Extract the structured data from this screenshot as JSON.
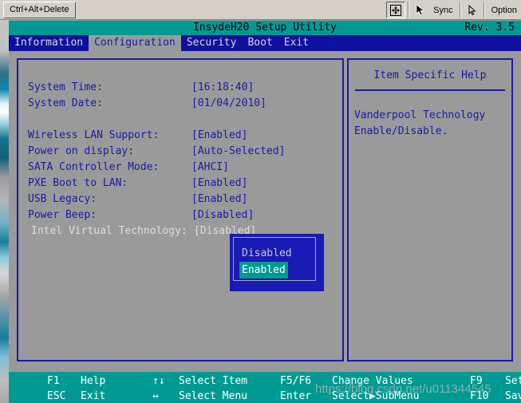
{
  "toolbar": {
    "cad_button": "Ctrl+Alt+Delete",
    "move_icon": "move-arrows-icon",
    "sync_icon": "cursor-arrow-icon",
    "sync_label": "Sync",
    "pointer_icon": "pointer-arrow-icon",
    "option_label": "Option"
  },
  "header": {
    "title": "InsydeH20 Setup Utility",
    "revision": "Rev. 3.5"
  },
  "menu": {
    "tabs": [
      {
        "label": "Information",
        "active": false
      },
      {
        "label": "Configuration",
        "active": true
      },
      {
        "label": "Security",
        "active": false
      },
      {
        "label": "Boot",
        "active": false
      },
      {
        "label": "Exit",
        "active": false
      }
    ]
  },
  "settings": [
    {
      "label": "System Time:",
      "value": "[16:18:40]",
      "selected": false
    },
    {
      "label": "System Date:",
      "value": "[01/04/2010]",
      "selected": false
    },
    {
      "label": "",
      "value": "",
      "selected": false
    },
    {
      "label": "Wireless LAN Support:",
      "value": "[Enabled]",
      "selected": false
    },
    {
      "label": "Power on display:",
      "value": "[Auto-Selected]",
      "selected": false
    },
    {
      "label": "SATA Controller Mode:",
      "value": "[AHCI]",
      "selected": false
    },
    {
      "label": "PXE Boot to LAN:",
      "value": "[Enabled]",
      "selected": false
    },
    {
      "label": "USB Legacy:",
      "value": "[Enabled]",
      "selected": false
    },
    {
      "label": "Power Beep:",
      "value": "[Disabled]",
      "selected": false
    },
    {
      "label": "Intel Virtual Technology:",
      "value": "[Disabled]",
      "selected": true
    }
  ],
  "help": {
    "title": "Item Specific Help",
    "line1": "Vanderpool Technology",
    "line2": "Enable/Disable."
  },
  "dropdown": {
    "options": [
      {
        "label": "Disabled",
        "selected": false
      },
      {
        "label": "Enabled",
        "selected": true
      }
    ]
  },
  "footer": {
    "row1": {
      "k1": "F1",
      "t1": "Help",
      "k2": "↑↓",
      "t2": "Select Item",
      "k3": "F5/F6",
      "t3": "Change Values",
      "k4": "F9",
      "t4": "Setup Default"
    },
    "row2": {
      "k1": "ESC",
      "t1": "Exit",
      "k2": "↔",
      "t2": "Select Menu",
      "k3": "Enter",
      "t3": "Select▶SubMenu",
      "k4": "F10",
      "t4": "Save and Exit"
    }
  },
  "watermark": "https://blog.csdn.net/u011344545",
  "colors": {
    "teal": "#009a93",
    "menu_blue": "#0f0fa0",
    "text_blue": "#1a1aa8",
    "body_gray": "#9a9a9a",
    "popup_blue": "#1a1ab4"
  }
}
